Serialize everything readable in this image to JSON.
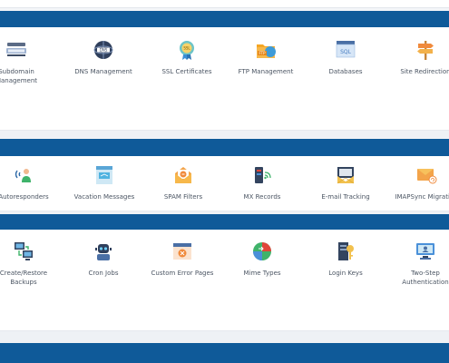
{
  "sections": [
    {
      "items": [
        {
          "label": "Subdomain\nManagement",
          "icon": "subdomain-icon"
        },
        {
          "label": "DNS Management",
          "icon": "dns-icon"
        },
        {
          "label": "SSL Certificates",
          "icon": "ssl-certificate-icon"
        },
        {
          "label": "FTP Management",
          "icon": "ftp-folder-icon"
        },
        {
          "label": "Databases",
          "icon": "sql-database-icon"
        },
        {
          "label": "Site Redirection",
          "icon": "signpost-icon"
        }
      ]
    },
    {
      "items": [
        {
          "label": "Autoresponders",
          "icon": "autoresponder-icon"
        },
        {
          "label": "Vacation Messages",
          "icon": "vacation-message-icon"
        },
        {
          "label": "SPAM Filters",
          "icon": "spam-filter-icon"
        },
        {
          "label": "MX Records",
          "icon": "mx-records-icon"
        },
        {
          "label": "E-mail Tracking",
          "icon": "email-tracking-icon"
        },
        {
          "label": "IMAPSync Migration",
          "icon": "imapsync-icon"
        }
      ]
    },
    {
      "items": [
        {
          "label": "Create/Restore\nBackups",
          "icon": "backup-icon"
        },
        {
          "label": "Cron Jobs",
          "icon": "cron-robot-icon"
        },
        {
          "label": "Custom Error Pages",
          "icon": "error-page-icon"
        },
        {
          "label": "Mime Types",
          "icon": "mime-types-icon"
        },
        {
          "label": "Login Keys",
          "icon": "login-keys-icon"
        },
        {
          "label": "Two-Step\nAuthentication",
          "icon": "two-step-auth-icon"
        }
      ]
    }
  ],
  "colors": {
    "header_band": "#0f5a99",
    "panel": "#ffffff",
    "page": "#f3f5f8",
    "label": "#4b5563"
  }
}
